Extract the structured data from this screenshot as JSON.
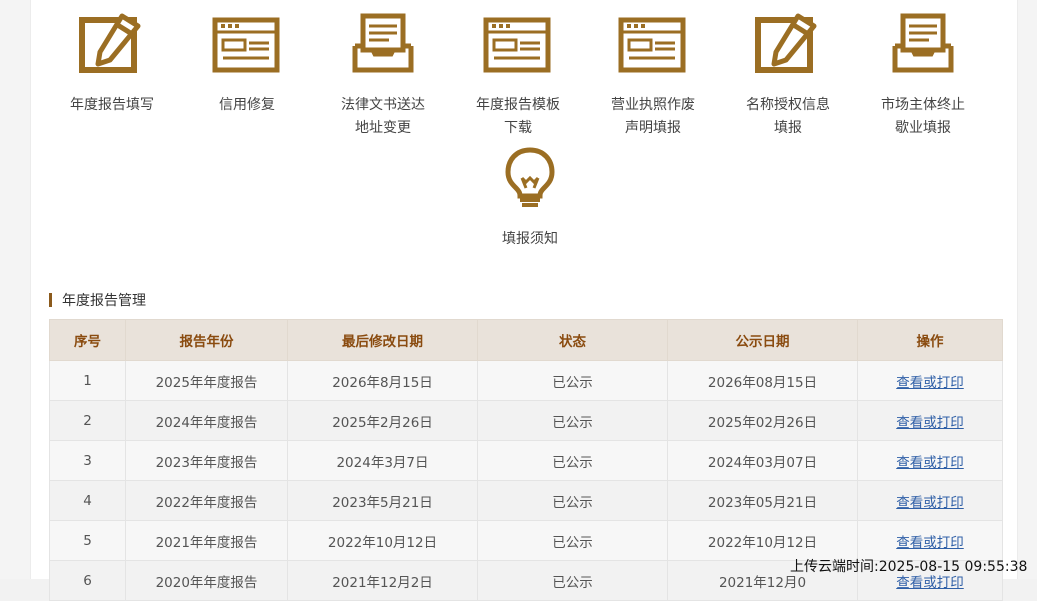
{
  "services": [
    {
      "name": "annual-report-fill",
      "label": "年度报告填写",
      "icon": "pencil-icon"
    },
    {
      "name": "credit-repair",
      "label": "信用修复",
      "icon": "form-icon"
    },
    {
      "name": "legal-address-change",
      "label": "法律文书送达\n地址变更",
      "icon": "tray-icon"
    },
    {
      "name": "report-template-download",
      "label": "年度报告模板\n下载",
      "icon": "form-icon"
    },
    {
      "name": "license-void-statement",
      "label": "营业执照作废\n声明填报",
      "icon": "form-icon"
    },
    {
      "name": "name-authorization",
      "label": "名称授权信息\n填报",
      "icon": "pencil-icon"
    },
    {
      "name": "termination-report",
      "label": "市场主体终止\n歇业填报",
      "icon": "tray-icon"
    },
    {
      "name": "filing-notice",
      "label": "填报须知",
      "icon": "lightbulb-icon"
    }
  ],
  "section": {
    "title": "年度报告管理"
  },
  "table": {
    "headers": [
      "序号",
      "报告年份",
      "最后修改日期",
      "状态",
      "公示日期",
      "操作"
    ],
    "rows": [
      [
        "1",
        "2025年年度报告",
        "2026年8月15日",
        "已公示",
        "2026年08月15日",
        "查看或打印"
      ],
      [
        "2",
        "2024年年度报告",
        "2025年2月26日",
        "已公示",
        "2025年02月26日",
        "查看或打印"
      ],
      [
        "3",
        "2023年年度报告",
        "2024年3月7日",
        "已公示",
        "2024年03月07日",
        "查看或打印"
      ],
      [
        "4",
        "2022年年度报告",
        "2023年5月21日",
        "已公示",
        "2023年05月21日",
        "查看或打印"
      ],
      [
        "5",
        "2021年年度报告",
        "2022年10月12日",
        "已公示",
        "2022年10月12日",
        "查看或打印"
      ],
      [
        "6",
        "2020年年度报告",
        "2021年12月2日",
        "已公示",
        "2021年12月0",
        "查看或打印"
      ]
    ]
  },
  "overlay": {
    "upload_time": "上传云端时间:2025-08-15 09:55:38"
  },
  "colors": {
    "icon_gold": "#9b6e23",
    "table_header_bg": "#e9e2da",
    "table_header_text": "#8a4b0f",
    "link": "#2f5fa7",
    "section_bar": "#8b5a1c"
  }
}
